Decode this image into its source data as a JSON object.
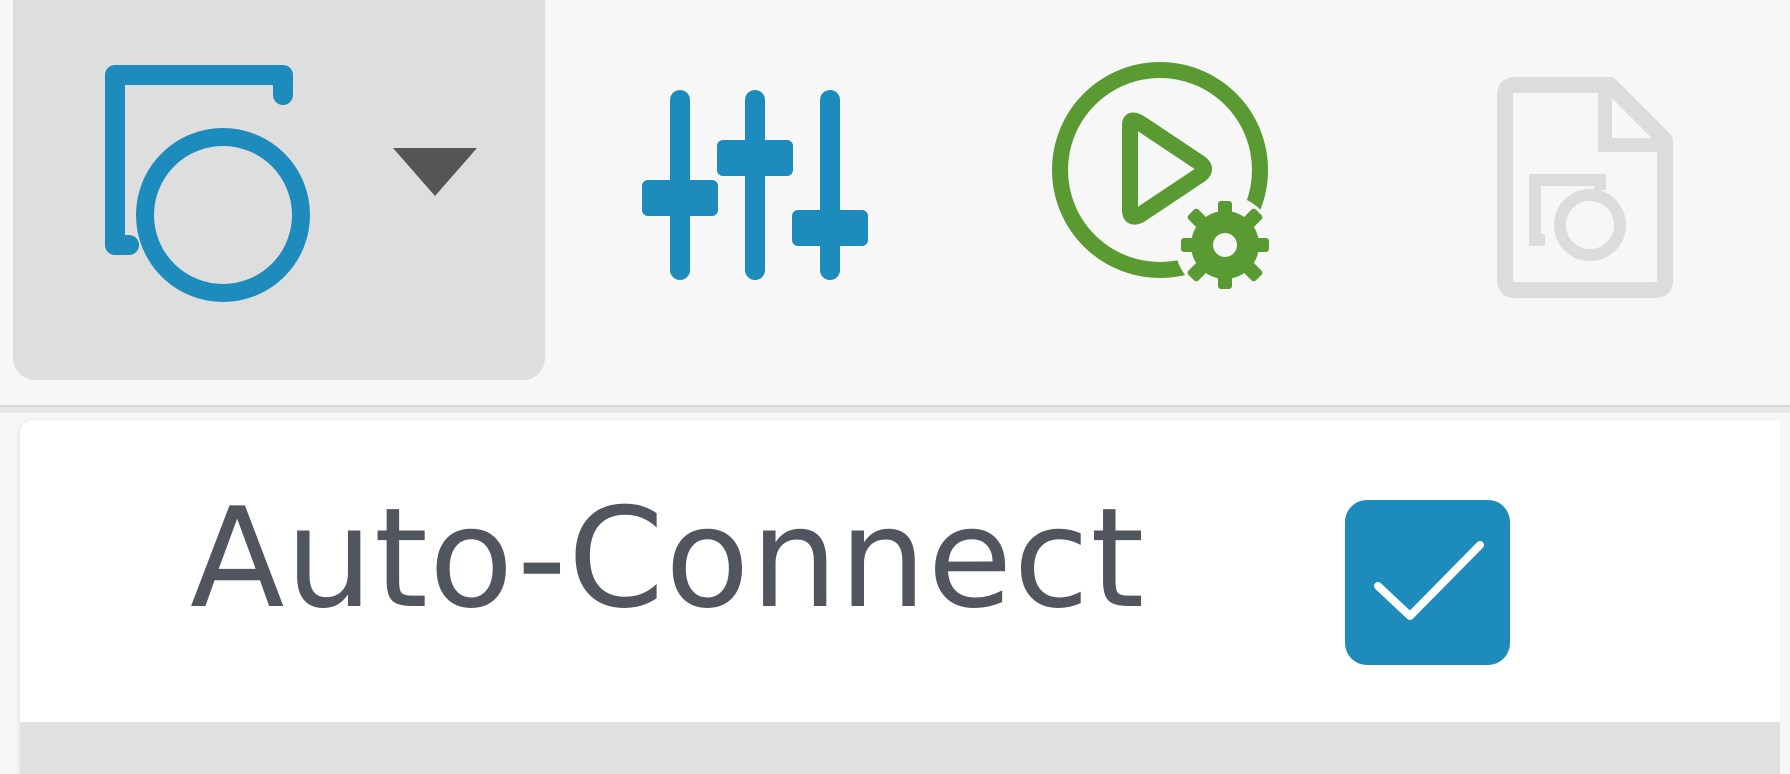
{
  "toolbar": {
    "connect_button": {
      "icon": "connect-icon",
      "has_dropdown": true,
      "state": "pressed"
    },
    "settings_button": {
      "icon": "sliders-icon"
    },
    "run_button": {
      "icon": "run-settings-icon"
    },
    "export_button": {
      "icon": "export-file-icon",
      "state": "disabled"
    }
  },
  "menu": {
    "items": [
      {
        "label": "Auto-Connect",
        "checked": true
      }
    ]
  },
  "colors": {
    "accent_blue": "#1e8bbd",
    "run_green": "#5a9a32",
    "disabled_gray": "#dcdcdc",
    "toolbar_bg": "#f7f7f7",
    "pressed_bg": "#dedede",
    "label_text": "#50555e"
  }
}
